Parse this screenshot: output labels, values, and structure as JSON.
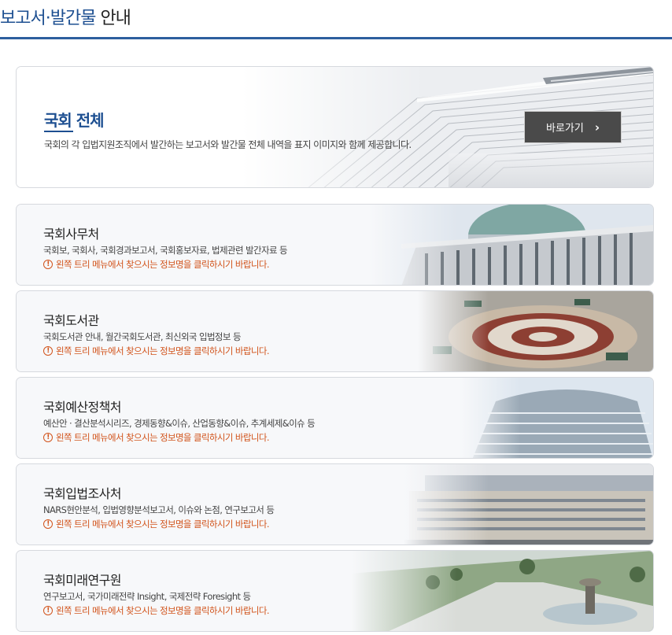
{
  "page": {
    "title_highlight": "보고서·발간물",
    "title_rest": "안내"
  },
  "main": {
    "title": "국회 전체",
    "description": "국회의 각 입법지원조직에서 발간하는 보고서와 발간물 전체 내역을 표지 이미지와 함께 제공합니다.",
    "button_label": "바로가기",
    "button_icon": "chevron-right-icon"
  },
  "notice_icon": "exclamation-circle-icon",
  "accent_color": "#1d4f91",
  "notice_color": "#d2541c",
  "organizations": [
    {
      "name": "국회사무처",
      "description": "국회보, 국회사, 국회경과보고서, 국회홍보자료, 법제관련 발간자료 등",
      "notice": "왼쪽 트리 메뉴에서 찾으시는 정보명을 클릭하시기 바랍니다."
    },
    {
      "name": "국회도서관",
      "description": "국회도서관 안내, 월간국회도서관, 최신외국 입법정보 등",
      "notice": "왼쪽 트리 메뉴에서 찾으시는 정보명을 클릭하시기 바랍니다."
    },
    {
      "name": "국회예산정책처",
      "description": "예산안 · 결산분석시리즈, 경제동향&이슈, 산업동향&이슈, 추계세제&이슈 등",
      "notice": "왼쪽 트리 메뉴에서 찾으시는 정보명을 클릭하시기 바랍니다."
    },
    {
      "name": "국회입법조사처",
      "description": "NARS현안분석, 입법영향분석보고서, 이슈와 논점, 연구보고서 등",
      "notice": "왼쪽 트리 메뉴에서 찾으시는 정보명을 클릭하시기 바랍니다."
    },
    {
      "name": "국회미래연구원",
      "description": "연구보고서, 국가미래전략 Insight, 국제전략 Foresight 등",
      "notice": "왼쪽 트리 메뉴에서 찾으시는 정보명을 클릭하시기 바랍니다."
    }
  ]
}
